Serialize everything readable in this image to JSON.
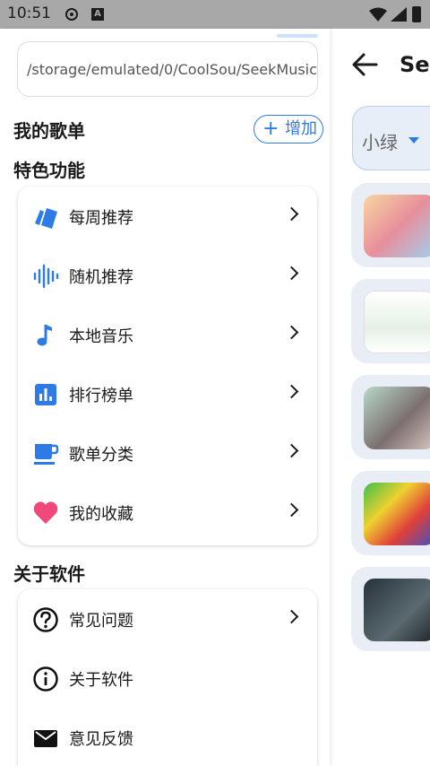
{
  "status_bar": {
    "time": "10:51",
    "icon_a": "A"
  },
  "background_page": {
    "title": "Se",
    "select_value": "小绿"
  },
  "drawer": {
    "storage_path": "/storage/emulated/0/CoolSou/SeekMusic",
    "my_playlists_title": "我的歌单",
    "add_button_label": "增加",
    "features_title": "特色功能",
    "features": [
      {
        "label": "每周推荐",
        "icon": "cards-icon"
      },
      {
        "label": "随机推荐",
        "icon": "waveform-icon"
      },
      {
        "label": "本地音乐",
        "icon": "music-note-icon"
      },
      {
        "label": "排行榜单",
        "icon": "bar-chart-icon"
      },
      {
        "label": "歌单分类",
        "icon": "cup-icon"
      },
      {
        "label": "我的收藏",
        "icon": "heart-icon"
      }
    ],
    "about_title": "关于软件",
    "about_items": [
      {
        "label": "常见问题",
        "icon": "question-icon"
      },
      {
        "label": "关于软件",
        "icon": "info-icon"
      },
      {
        "label": "意见反馈",
        "icon": "mail-icon"
      }
    ]
  },
  "colors": {
    "accent": "#2f7be6",
    "heart": "#f0487a"
  }
}
